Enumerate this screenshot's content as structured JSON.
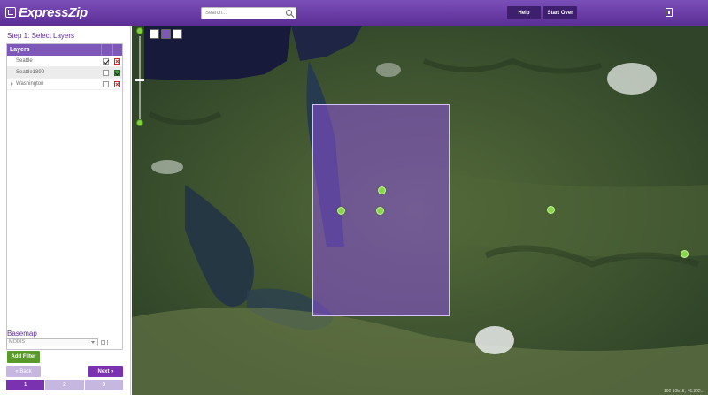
{
  "app": {
    "logo_text": "ExpressZip"
  },
  "header": {
    "search_placeholder": "Search...",
    "help_label": "Help",
    "start_over_label": "Start Over"
  },
  "sidebar": {
    "step_title": "Step 1: Select Layers",
    "layers_header": "Layers",
    "layers": [
      {
        "label": "Seattle",
        "checked": true,
        "expandable": false
      },
      {
        "label": "Seattle1890",
        "checked": true,
        "expandable": false
      },
      {
        "label": "Washington",
        "checked": false,
        "expandable": true
      }
    ],
    "basemap_label": "Basemap",
    "basemap_selected": "MODIS",
    "add_filter_label": "Add Filter",
    "back_label": "« Back",
    "next_label": "Next »",
    "steps": [
      "1",
      "2",
      "3"
    ],
    "active_step": "1"
  },
  "map": {
    "attribution": "100 10b15, 46.322..."
  },
  "colors": {
    "header_purple": "#5b2e96",
    "accent_purple": "#7a32b0",
    "selection_fill": "#8c50dc",
    "marker_green": "#8ad64a",
    "filter_green": "#5a9a2a"
  }
}
